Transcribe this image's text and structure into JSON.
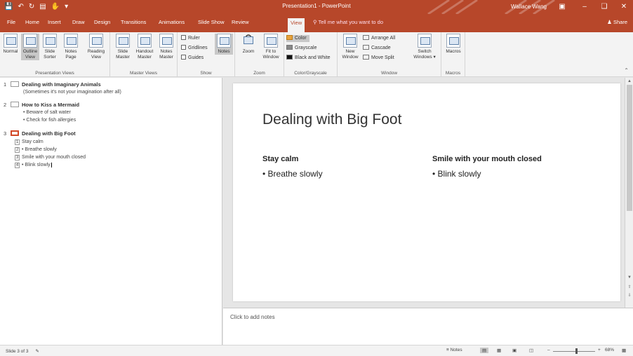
{
  "titlebar": {
    "doc_title": "Presentation1 - PowerPoint",
    "user": "Wallace Wang",
    "qat": [
      "save-icon",
      "undo-icon",
      "redo-icon",
      "start-icon",
      "touch-icon",
      "customize-icon"
    ]
  },
  "tabs": [
    "File",
    "Home",
    "Insert",
    "Draw",
    "Design",
    "Transitions",
    "Animations",
    "Slide Show",
    "Review",
    "View"
  ],
  "active_tab": "View",
  "tell_me": "Tell me what you want to do",
  "share": "Share",
  "ribbon": {
    "presentation_views": {
      "label": "Presentation Views",
      "buttons": [
        {
          "l1": "Normal",
          "l2": ""
        },
        {
          "l1": "Outline",
          "l2": "View"
        },
        {
          "l1": "Slide",
          "l2": "Sorter"
        },
        {
          "l1": "Notes",
          "l2": "Page"
        },
        {
          "l1": "Reading",
          "l2": "View"
        }
      ]
    },
    "master_views": {
      "label": "Master Views",
      "buttons": [
        {
          "l1": "Slide",
          "l2": "Master"
        },
        {
          "l1": "Handout",
          "l2": "Master"
        },
        {
          "l1": "Notes",
          "l2": "Master"
        }
      ]
    },
    "show": {
      "label": "Show",
      "ruler": "Ruler",
      "gridlines": "Gridlines",
      "guides": "Guides",
      "notes": "Notes"
    },
    "zoom": {
      "label": "Zoom",
      "zoom": "Zoom",
      "fit_l1": "Fit to",
      "fit_l2": "Window"
    },
    "color": {
      "label": "Color/Grayscale",
      "color": "Color",
      "grayscale": "Grayscale",
      "bw": "Black and White"
    },
    "window": {
      "label": "Window",
      "new_l1": "New",
      "new_l2": "Window",
      "arrange": "Arrange All",
      "cascade": "Cascade",
      "move_split": "Move Split",
      "switch_l1": "Switch",
      "switch_l2": "Windows"
    },
    "macros": {
      "label": "Macros",
      "button": "Macros"
    }
  },
  "outline": {
    "slides": [
      {
        "num": "1",
        "title": "Dealing with Imaginary Animals",
        "lines": [
          "(Sometimes it's not your imagination after all)"
        ]
      },
      {
        "num": "2",
        "title": "How to Kiss a Mermaid",
        "lines": [
          "• Beware of salt water",
          "• Check for fish allergies"
        ]
      },
      {
        "num": "3",
        "title": "Dealing with Big Foot",
        "levels": [
          {
            "n": "1",
            "text": "Stay calm"
          },
          {
            "n": "2",
            "text": "• Breathe slowly"
          },
          {
            "n": "3",
            "text": "Smile with your mouth closed"
          },
          {
            "n": "4",
            "text": "• Blink slowly"
          }
        ]
      }
    ]
  },
  "slide": {
    "title": "Dealing with Big Foot",
    "left_head": "Stay calm",
    "left_bullet": "• Breathe slowly",
    "right_head": "Smile with your mouth closed",
    "right_bullet": "• Blink slowly"
  },
  "notes_placeholder": "Click to add notes",
  "status": {
    "slide_info": "Slide 3 of 3",
    "notes": "Notes",
    "zoom": "68%"
  },
  "colors": {
    "accent": "#b7472a",
    "current_slide": "#d24726"
  }
}
